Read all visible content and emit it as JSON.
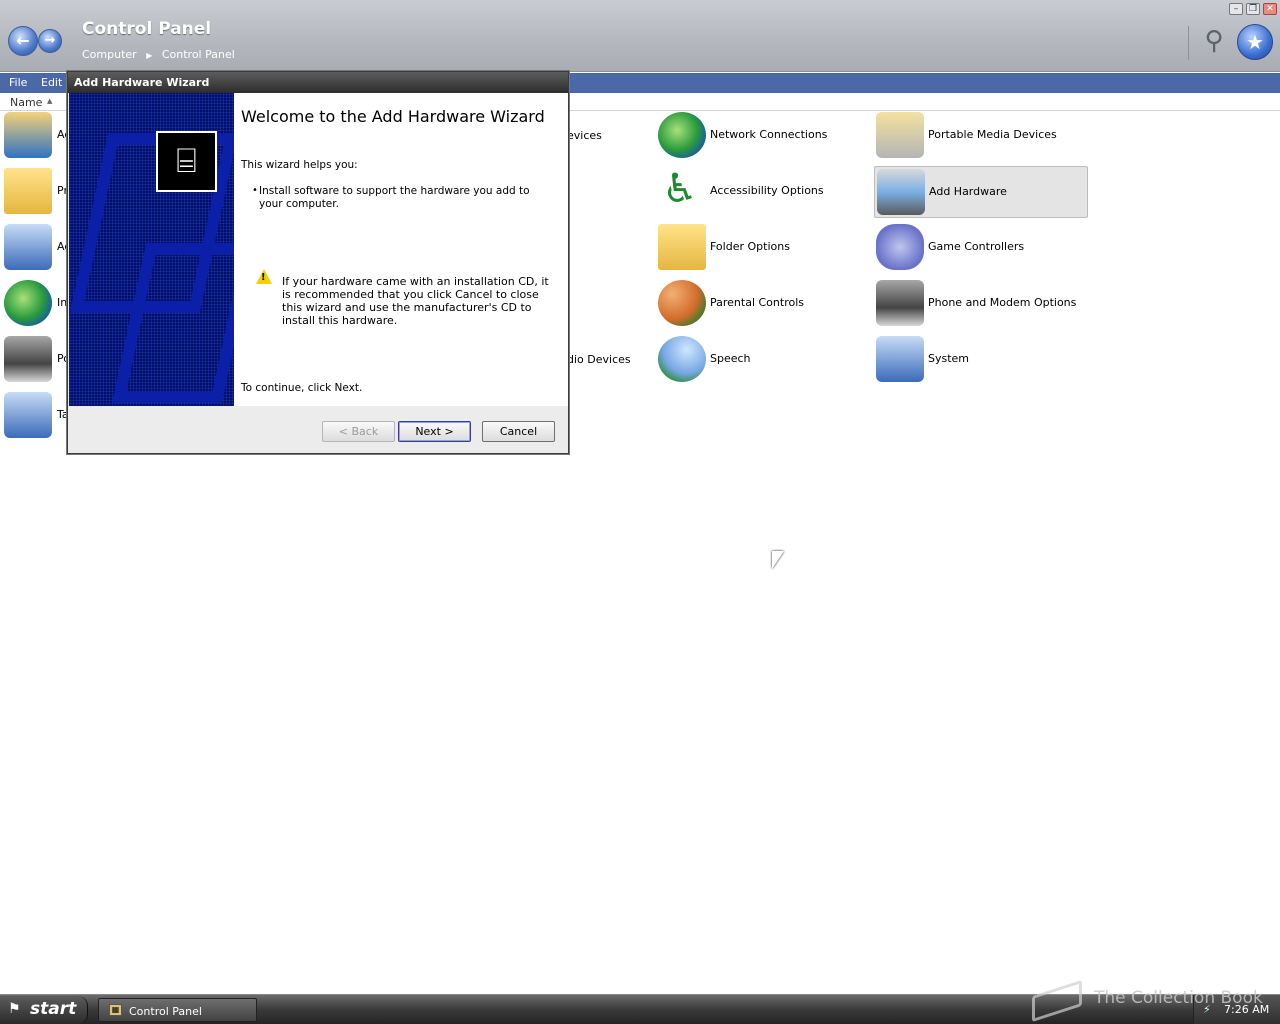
{
  "window": {
    "title": "Control Panel",
    "breadcrumb": [
      "Computer",
      "Control Panel"
    ]
  },
  "menu": [
    "File",
    "Edit"
  ],
  "column_header": {
    "name": "Name"
  },
  "items": [
    {
      "label": "Network Connections",
      "icon": "network-icon"
    },
    {
      "label": "Accessibility Options",
      "icon": "accessibility-icon"
    },
    {
      "label": "Folder Options",
      "icon": "folder-icon"
    },
    {
      "label": "Parental Controls",
      "icon": "parental-icon"
    },
    {
      "label": "Speech",
      "icon": "speech-icon"
    },
    {
      "label": "Portable Media Devices",
      "icon": "media-device-icon"
    },
    {
      "label": "Add Hardware",
      "icon": "add-hardware-icon",
      "selected": true
    },
    {
      "label": "Game Controllers",
      "icon": "gamepad-icon"
    },
    {
      "label": "Phone and Modem Options",
      "icon": "phone-icon"
    },
    {
      "label": "System",
      "icon": "system-icon"
    }
  ],
  "partial_items": [
    {
      "label": "evices"
    },
    {
      "label": "dio Devices"
    },
    {
      "label": "Ad"
    },
    {
      "label": "Pr"
    },
    {
      "label": "Ad"
    },
    {
      "label": "In"
    },
    {
      "label": "Po"
    },
    {
      "label": "Ta"
    }
  ],
  "dialog": {
    "title": "Add Hardware Wizard",
    "heading": "Welcome to the Add Hardware Wizard",
    "intro": "This wizard helps you:",
    "bullet": "Install software to support the hardware you add to your computer.",
    "warning": "If your hardware came with an installation CD, it is recommended that you click Cancel to close this wizard and use the manufacturer's CD to install this hardware.",
    "continue_text": "To continue, click Next.",
    "buttons": {
      "back": "< Back",
      "next": "Next >",
      "cancel": "Cancel"
    }
  },
  "taskbar": {
    "start": "start",
    "task": "Control Panel",
    "clock": "7:26 AM",
    "watermark": "The Collection Book"
  }
}
